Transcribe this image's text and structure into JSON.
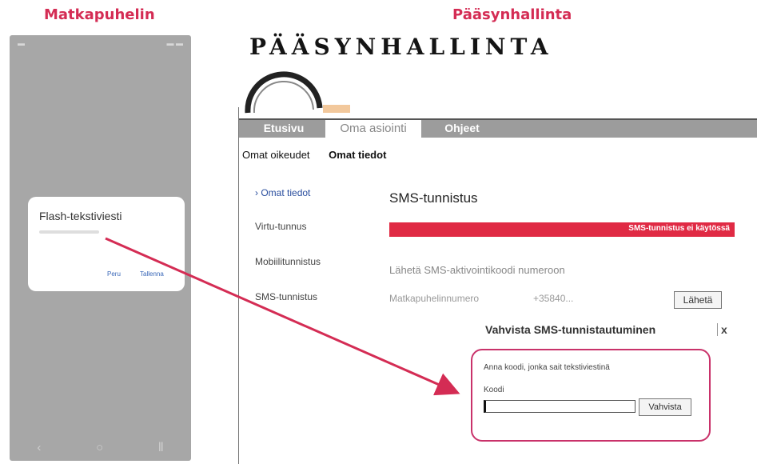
{
  "captions": {
    "left": "Matkapuhelin",
    "right": "Pääsynhallinta"
  },
  "phone": {
    "dialog_title": "Flash-tekstiviesti",
    "cancel_label": "Peru",
    "save_label": "Tallenna"
  },
  "web": {
    "logo_text": "PÄÄSYNHALLINTA",
    "tabs": [
      "Etusivu",
      "Oma asiointi",
      "Ohjeet"
    ],
    "subnav": [
      "Omat oikeudet",
      "Omat tiedot"
    ],
    "sidebar": [
      "Omat tiedot",
      "Virtu-tunnus",
      "Mobiilitunnistus",
      "SMS-tunnistus"
    ],
    "main_title": "SMS-tunnistus",
    "status_text": "SMS-tunnistus ei käytössä",
    "send_text": "Lähetä SMS-aktivointikoodi numeroon",
    "phone_label": "Matkapuhelinnumero",
    "phone_value": "+35840...",
    "send_button": "Lähetä",
    "confirm_title": "Vahvista SMS-tunnistautuminen",
    "close_label": "x",
    "confirm_instruction": "Anna koodi, jonka sait tekstiviestinä",
    "code_label": "Koodi",
    "code_value": "",
    "confirm_button": "Vahvista"
  },
  "colors": {
    "caption": "#d42c54",
    "status_bar": "#e02a44",
    "highlight": "#c9326a",
    "arrow": "#d42c54"
  }
}
